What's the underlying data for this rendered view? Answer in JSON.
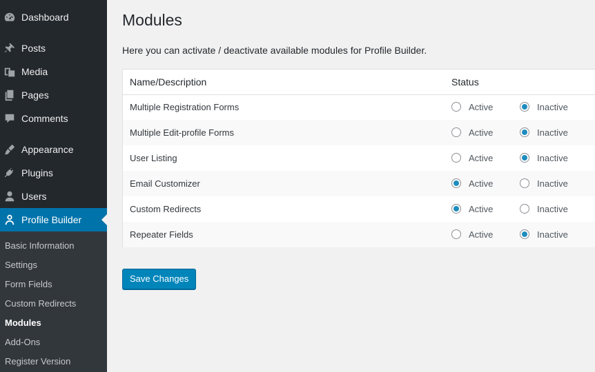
{
  "sidebar": {
    "items": [
      {
        "label": "Dashboard",
        "icon": "dashboard-icon"
      },
      {
        "label": "Posts",
        "icon": "pushpin-icon"
      },
      {
        "label": "Media",
        "icon": "media-icon"
      },
      {
        "label": "Pages",
        "icon": "pages-icon"
      },
      {
        "label": "Comments",
        "icon": "comment-bubble-icon"
      },
      {
        "label": "Appearance",
        "icon": "paintbrush-icon"
      },
      {
        "label": "Plugins",
        "icon": "plug-icon"
      },
      {
        "label": "Users",
        "icon": "users-icon"
      },
      {
        "label": "Profile Builder",
        "icon": "profile-user-icon"
      }
    ],
    "submenu": [
      {
        "label": "Basic Information"
      },
      {
        "label": "Settings"
      },
      {
        "label": "Form Fields"
      },
      {
        "label": "Custom Redirects"
      },
      {
        "label": "Modules"
      },
      {
        "label": "Add-Ons"
      },
      {
        "label": "Register Version"
      }
    ]
  },
  "main": {
    "title": "Modules",
    "intro": "Here you can activate / deactivate available modules for Profile Builder.",
    "table": {
      "headers": {
        "name": "Name/Description",
        "status": "Status"
      },
      "active_label": "Active",
      "inactive_label": "Inactive",
      "rows": [
        {
          "name": "Multiple Registration Forms",
          "status": "Inactive"
        },
        {
          "name": "Multiple Edit-profile Forms",
          "status": "Inactive"
        },
        {
          "name": "User Listing",
          "status": "Inactive"
        },
        {
          "name": "Email Customizer",
          "status": "Active"
        },
        {
          "name": "Custom Redirects",
          "status": "Active"
        },
        {
          "name": "Repeater Fields",
          "status": "Inactive"
        }
      ]
    },
    "save_label": "Save Changes"
  },
  "colors": {
    "sidebar_bg": "#23282d",
    "submenu_bg": "#32373c",
    "accent": "#0073aa",
    "button": "#0085ba",
    "radio_checked": "#1e8cbe"
  }
}
